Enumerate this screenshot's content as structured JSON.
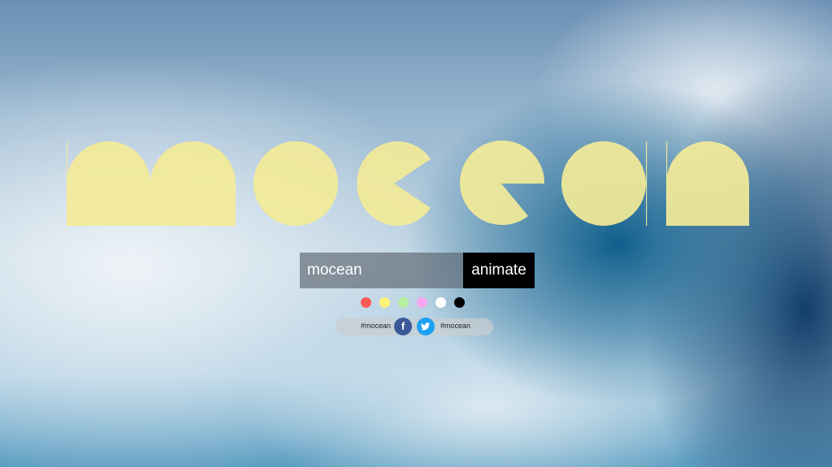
{
  "logo": {
    "text": "mocean",
    "color": "#f3ea98"
  },
  "form": {
    "input_value": "mocean",
    "button_label": "animate"
  },
  "color_swatches": [
    {
      "name": "red",
      "color": "#ff5a5a"
    },
    {
      "name": "yellow",
      "color": "#fff27a"
    },
    {
      "name": "green",
      "color": "#b6f0a0"
    },
    {
      "name": "pink",
      "color": "#f6a6f0"
    },
    {
      "name": "white",
      "color": "#ffffff"
    },
    {
      "name": "black",
      "color": "#000000"
    }
  ],
  "share": {
    "left_tag": "#mocean",
    "right_tag": "#mocean",
    "facebook_icon": "f",
    "facebook_color": "#3b5998",
    "twitter_color": "#1da1f2"
  }
}
